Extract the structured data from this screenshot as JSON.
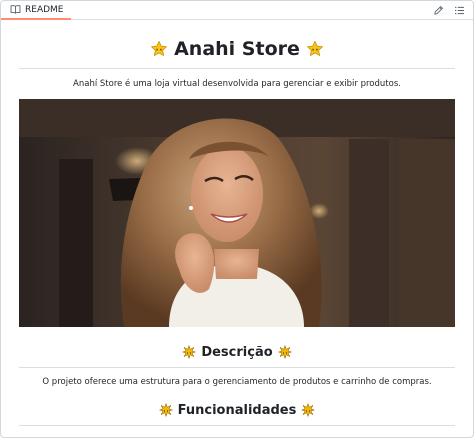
{
  "tab": {
    "label": "README",
    "icon": "book-icon"
  },
  "actions": [
    {
      "name": "edit-icon"
    },
    {
      "name": "list-icon"
    }
  ],
  "readme": {
    "title": "Anahi Store",
    "title_emoji": "star-emoji",
    "intro": "Anahí Store é uma loja virtual desenvolvida para gerenciar e exibir produtos.",
    "photo": "portrait-photo",
    "section_description": {
      "heading": "Descrição",
      "emoji": "sparkle-emoji",
      "text": "O projeto oferece uma estrutura para o gerenciamento de produtos e carrinho de compras."
    },
    "section_features": {
      "heading": "Funcionalidades",
      "emoji": "sparkle-emoji"
    }
  },
  "colors": {
    "tab_underline": "#fd8c73",
    "border": "#d8dee4",
    "text": "#1f2328",
    "star": "#f5c518",
    "sparkle": "#f5b800"
  }
}
